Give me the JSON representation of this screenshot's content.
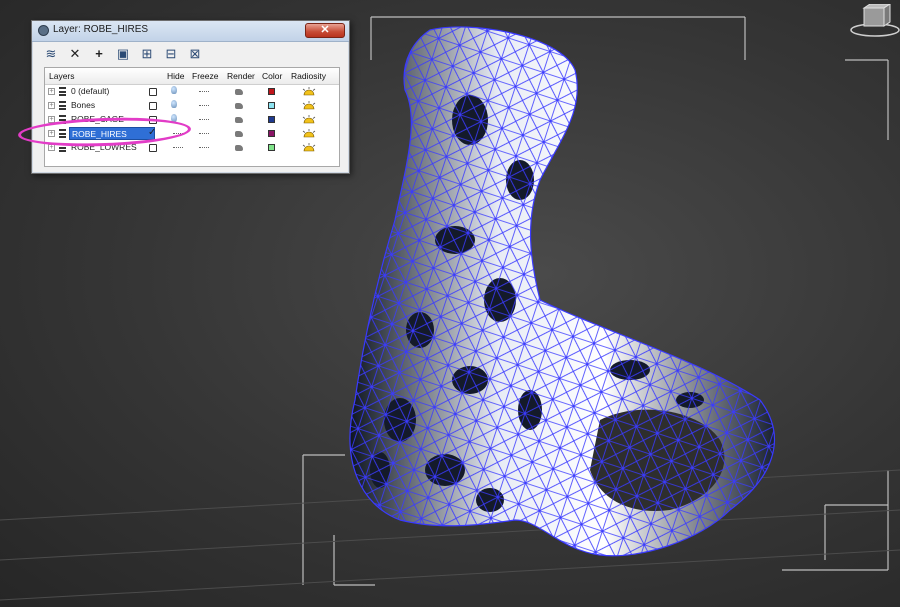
{
  "dialog": {
    "title": "Layer: ROBE_HIRES",
    "close_label": "✕"
  },
  "toolbar": {
    "buttons": [
      {
        "name": "create-layer-icon",
        "glyph": "≋"
      },
      {
        "name": "delete-layer-icon",
        "glyph": "✕"
      },
      {
        "name": "add-to-layer-icon",
        "glyph": "+"
      },
      {
        "name": "select-objects-icon",
        "glyph": "▣"
      },
      {
        "name": "highlight-layer-icon",
        "glyph": "⊞"
      },
      {
        "name": "hide-all-icon",
        "glyph": "⊟"
      },
      {
        "name": "freeze-all-icon",
        "glyph": "⊠"
      }
    ]
  },
  "columns": {
    "layers": "Layers",
    "hide": "Hide",
    "freeze": "Freeze",
    "render": "Render",
    "color": "Color",
    "radiosity": "Radiosity"
  },
  "layers": [
    {
      "name": "0 (default)",
      "color": "#c0151a",
      "active": false
    },
    {
      "name": "Bones",
      "color": "#8de3f0",
      "active": false
    },
    {
      "name": "ROBE_CAGE",
      "color": "#1f3a8f",
      "active": false
    },
    {
      "name": "ROBE_HIRES",
      "color": "#8a1466",
      "active": true
    },
    {
      "name": "ROBE_LOWRES",
      "color": "#7fe38a",
      "active": false
    }
  ],
  "colors": {
    "highlight_ellipse": "#e23cc7",
    "wireframe": "#3a3aff",
    "viewport_bg": "#3b3b3b"
  }
}
